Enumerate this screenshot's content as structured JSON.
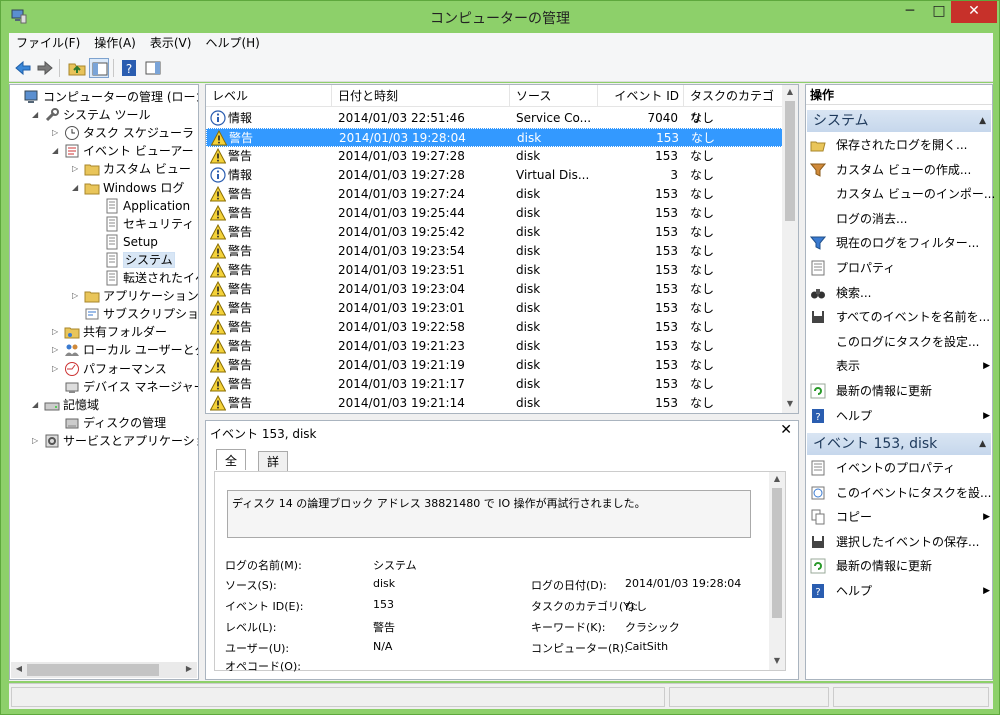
{
  "window": {
    "title": "コンピューターの管理",
    "min": "─",
    "max": "□",
    "close": "✕"
  },
  "menu": [
    "ファイル(F)",
    "操作(A)",
    "表示(V)",
    "ヘルプ(H)"
  ],
  "tree": [
    {
      "label": "コンピューターの管理 (ローカル)",
      "level": 0,
      "tw": "",
      "icon": "computer-icon"
    },
    {
      "label": "システム ツール",
      "level": 1,
      "tw": "◢",
      "icon": "tools-icon"
    },
    {
      "label": "タスク スケジューラ",
      "level": 2,
      "tw": "▷",
      "icon": "clock-icon"
    },
    {
      "label": "イベント ビューアー",
      "level": 2,
      "tw": "◢",
      "icon": "event-viewer-icon"
    },
    {
      "label": "カスタム ビュー",
      "level": 3,
      "tw": "▷",
      "icon": "folder-icon"
    },
    {
      "label": "Windows ログ",
      "level": 3,
      "tw": "◢",
      "icon": "folder-icon"
    },
    {
      "label": "Application",
      "level": 4,
      "tw": "",
      "icon": "log-icon"
    },
    {
      "label": "セキュリティ",
      "level": 4,
      "tw": "",
      "icon": "log-icon"
    },
    {
      "label": "Setup",
      "level": 4,
      "tw": "",
      "icon": "log-icon"
    },
    {
      "label": "システム",
      "level": 4,
      "tw": "",
      "icon": "log-icon"
    },
    {
      "label": "転送されたイベント",
      "level": 4,
      "tw": "",
      "icon": "log-icon"
    },
    {
      "label": "アプリケーションとサービ",
      "level": 3,
      "tw": "▷",
      "icon": "folder-icon"
    },
    {
      "label": "サブスクリプション",
      "level": 3,
      "tw": "",
      "icon": "subscription-icon"
    },
    {
      "label": "共有フォルダー",
      "level": 2,
      "tw": "▷",
      "icon": "shared-folder-icon"
    },
    {
      "label": "ローカル ユーザーとグループ",
      "level": 2,
      "tw": "▷",
      "icon": "users-icon"
    },
    {
      "label": "パフォーマンス",
      "level": 2,
      "tw": "▷",
      "icon": "performance-icon"
    },
    {
      "label": "デバイス マネージャー",
      "level": 2,
      "tw": "",
      "icon": "device-manager-icon"
    },
    {
      "label": "記憶域",
      "level": 1,
      "tw": "◢",
      "icon": "storage-icon"
    },
    {
      "label": "ディスクの管理",
      "level": 2,
      "tw": "",
      "icon": "disk-icon"
    },
    {
      "label": "サービスとアプリケーション",
      "level": 1,
      "tw": "▷",
      "icon": "services-icon"
    }
  ],
  "list": {
    "headers": [
      "レベル",
      "日付と時刻",
      "ソース",
      "イベント ID",
      "タスクのカテゴリ"
    ],
    "rows": [
      {
        "level": "情報",
        "time": "2014/01/03 22:51:46",
        "source": "Service Co...",
        "id": "7040",
        "cat": "なし",
        "type": "info"
      },
      {
        "level": "警告",
        "time": "2014/01/03 19:28:04",
        "source": "disk",
        "id": "153",
        "cat": "なし",
        "type": "warn"
      },
      {
        "level": "警告",
        "time": "2014/01/03 19:27:28",
        "source": "disk",
        "id": "153",
        "cat": "なし",
        "type": "warn"
      },
      {
        "level": "情報",
        "time": "2014/01/03 19:27:28",
        "source": "Virtual Dis...",
        "id": "3",
        "cat": "なし",
        "type": "info"
      },
      {
        "level": "警告",
        "time": "2014/01/03 19:27:24",
        "source": "disk",
        "id": "153",
        "cat": "なし",
        "type": "warn"
      },
      {
        "level": "警告",
        "time": "2014/01/03 19:25:44",
        "source": "disk",
        "id": "153",
        "cat": "なし",
        "type": "warn"
      },
      {
        "level": "警告",
        "time": "2014/01/03 19:25:42",
        "source": "disk",
        "id": "153",
        "cat": "なし",
        "type": "warn"
      },
      {
        "level": "警告",
        "time": "2014/01/03 19:23:54",
        "source": "disk",
        "id": "153",
        "cat": "なし",
        "type": "warn"
      },
      {
        "level": "警告",
        "time": "2014/01/03 19:23:51",
        "source": "disk",
        "id": "153",
        "cat": "なし",
        "type": "warn"
      },
      {
        "level": "警告",
        "time": "2014/01/03 19:23:04",
        "source": "disk",
        "id": "153",
        "cat": "なし",
        "type": "warn"
      },
      {
        "level": "警告",
        "time": "2014/01/03 19:23:01",
        "source": "disk",
        "id": "153",
        "cat": "なし",
        "type": "warn"
      },
      {
        "level": "警告",
        "time": "2014/01/03 19:22:58",
        "source": "disk",
        "id": "153",
        "cat": "なし",
        "type": "warn"
      },
      {
        "level": "警告",
        "time": "2014/01/03 19:21:23",
        "source": "disk",
        "id": "153",
        "cat": "なし",
        "type": "warn"
      },
      {
        "level": "警告",
        "time": "2014/01/03 19:21:19",
        "source": "disk",
        "id": "153",
        "cat": "なし",
        "type": "warn"
      },
      {
        "level": "警告",
        "time": "2014/01/03 19:21:17",
        "source": "disk",
        "id": "153",
        "cat": "なし",
        "type": "warn"
      },
      {
        "level": "警告",
        "time": "2014/01/03 19:21:14",
        "source": "disk",
        "id": "153",
        "cat": "なし",
        "type": "warn"
      }
    ]
  },
  "detail": {
    "title": "イベント 153, disk",
    "close": "✕",
    "tabs": [
      "全般",
      "詳細"
    ],
    "message": "ディスク 14 の論理ブロック アドレス 38821480 で IO 操作が再試行されました。",
    "fields": {
      "log_name_label": "ログの名前(M):",
      "log_name": "システム",
      "source_label": "ソース(S):",
      "source": "disk",
      "date_label": "ログの日付(D):",
      "date": "2014/01/03 19:28:04",
      "event_id_label": "イベント ID(E):",
      "event_id": "153",
      "category_label": "タスクのカテゴリ(Y):",
      "category": "なし",
      "level_label": "レベル(L):",
      "level": "警告",
      "keyword_label": "キーワード(K):",
      "keyword": "クラシック",
      "user_label": "ユーザー(U):",
      "user": "N/A",
      "computer_label": "コンピューター(R):",
      "computer": "CaitSith",
      "opcode_label": "オペコード(O):"
    }
  },
  "actions": {
    "header": "操作",
    "section1": "システム",
    "items1": [
      {
        "label": "保存されたログを開く...",
        "icon": "open-log-icon",
        "arrow": false
      },
      {
        "label": "カスタム ビューの作成...",
        "icon": "filter-create-icon",
        "arrow": false
      },
      {
        "label": "カスタム ビューのインポー...",
        "icon": "",
        "arrow": false
      },
      {
        "label": "ログの消去...",
        "icon": "",
        "arrow": false
      },
      {
        "label": "現在のログをフィルター...",
        "icon": "filter-icon",
        "arrow": false
      },
      {
        "label": "プロパティ",
        "icon": "properties-icon",
        "arrow": false
      },
      {
        "label": "検索...",
        "icon": "binoculars-icon",
        "arrow": false
      },
      {
        "label": "すべてのイベントを名前を...",
        "icon": "save-icon",
        "arrow": false
      },
      {
        "label": "このログにタスクを設定...",
        "icon": "",
        "arrow": false
      },
      {
        "label": "表示",
        "icon": "",
        "arrow": true
      },
      {
        "label": "最新の情報に更新",
        "icon": "refresh-icon",
        "arrow": false
      },
      {
        "label": "ヘルプ",
        "icon": "help-icon",
        "arrow": true
      }
    ],
    "section2": "イベント 153, disk",
    "items2": [
      {
        "label": "イベントのプロパティ",
        "icon": "properties-icon",
        "arrow": false
      },
      {
        "label": "このイベントにタスクを設...",
        "icon": "task-icon",
        "arrow": false
      },
      {
        "label": "コピー",
        "icon": "copy-icon",
        "arrow": true
      },
      {
        "label": "選択したイベントの保存...",
        "icon": "save-icon",
        "arrow": false
      },
      {
        "label": "最新の情報に更新",
        "icon": "refresh-icon",
        "arrow": false
      },
      {
        "label": "ヘルプ",
        "icon": "help-icon",
        "arrow": true
      }
    ]
  }
}
